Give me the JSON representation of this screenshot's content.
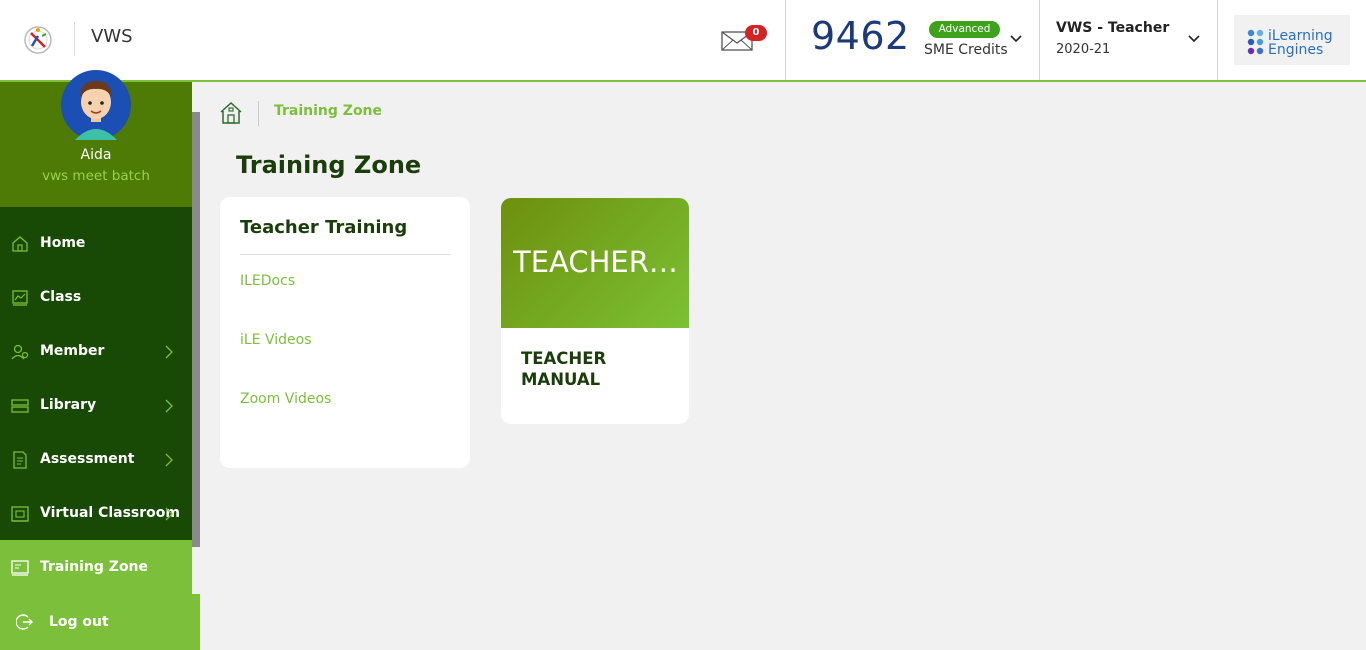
{
  "header": {
    "app_title": "VWS",
    "mail_count": "0",
    "credits": {
      "value": "9462",
      "badge": "Advanced",
      "label": "SME Credits"
    },
    "role": {
      "title": "VWS - Teacher",
      "year": "2020-21"
    },
    "brand": {
      "line1": "iLearning",
      "line2": "Engines"
    }
  },
  "profile": {
    "name": "Aida",
    "batch": "vws meet batch"
  },
  "sidebar": {
    "items": [
      {
        "label": "Home",
        "icon": "home-icon",
        "has_submenu": false
      },
      {
        "label": "Class",
        "icon": "class-icon",
        "has_submenu": false
      },
      {
        "label": "Member",
        "icon": "member-icon",
        "has_submenu": true
      },
      {
        "label": "Library",
        "icon": "library-icon",
        "has_submenu": true
      },
      {
        "label": "Assessment",
        "icon": "assessment-icon",
        "has_submenu": true
      },
      {
        "label": "Virtual Classroom",
        "icon": "virtual-classroom-icon",
        "has_submenu": true
      },
      {
        "label": "Training Zone",
        "icon": "training-zone-icon",
        "has_submenu": false,
        "active": true
      }
    ],
    "logout_label": "Log out"
  },
  "breadcrumb": {
    "current": "Training Zone"
  },
  "page_title": "Training Zone",
  "teacher_training": {
    "title": "Teacher Training",
    "links": [
      "ILEDocs",
      "iLE Videos",
      "Zoom Videos"
    ]
  },
  "course_card": {
    "banner_text": "TEACHER MANUAL",
    "title": "TEACHER MANUAL"
  },
  "colors": {
    "accent": "#7bbf3a",
    "sidebar": "#184a05",
    "profile_bg": "#4e7a06",
    "credits_number": "#1c3a7a",
    "badge_green": "#3fa21d",
    "mail_badge": "#d32323"
  }
}
